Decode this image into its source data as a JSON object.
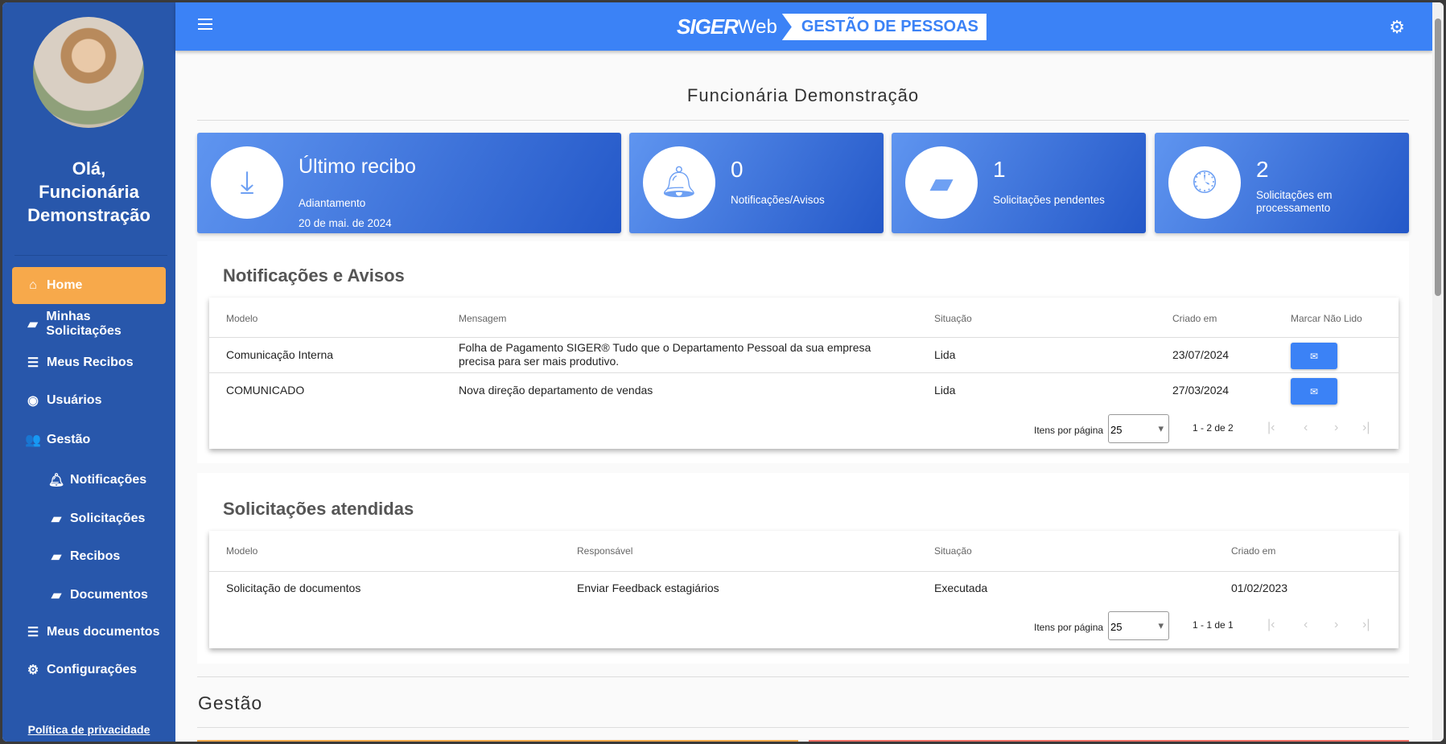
{
  "sidebar": {
    "greeting": "Olá,",
    "name_line1": "Funcionária",
    "name_line2": "Demonstração",
    "items": [
      {
        "label": "Home"
      },
      {
        "label": "Minhas Solicitações"
      },
      {
        "label": "Meus Recibos"
      },
      {
        "label": "Usuários"
      },
      {
        "label": "Gestão"
      },
      {
        "label": "Notificações"
      },
      {
        "label": "Solicitações"
      },
      {
        "label": "Recibos"
      },
      {
        "label": "Documentos"
      },
      {
        "label": "Meus documentos"
      },
      {
        "label": "Configurações"
      }
    ],
    "privacy": "Política de privacidade"
  },
  "header": {
    "logo_siger": "SIGER",
    "logo_web": "Web",
    "logo_product": "GESTÃO DE PESSOAS"
  },
  "page_title": "Funcionária Demonstração",
  "cards": {
    "receipt": {
      "title": "Último recibo",
      "type": "Adiantamento",
      "date": "20 de mai. de 2024"
    },
    "notifications": {
      "count": "0",
      "label": "Notificações/Avisos"
    },
    "pending": {
      "count": "1",
      "label": "Solicitações pendentes"
    },
    "processing": {
      "count": "2",
      "label": "Solicitações em processamento"
    }
  },
  "notifications": {
    "title": "Notificações e Avisos",
    "headers": [
      "Modelo",
      "Mensagem",
      "Situação",
      "Criado em",
      "Marcar Não Lido"
    ],
    "rows": [
      {
        "modelo": "Comunicação Interna",
        "mensagem": "Folha de Pagamento SIGER® Tudo que o Departamento Pessoal da sua empresa precisa para ser mais produtivo.",
        "situacao": "Lida",
        "criado": "23/07/2024"
      },
      {
        "modelo": "COMUNICADO",
        "mensagem": "Nova direção departamento de vendas",
        "situacao": "Lida",
        "criado": "27/03/2024"
      }
    ],
    "items_per_page_label": "Itens por página",
    "items_per_page": "25",
    "range": "1 - 2 de 2"
  },
  "requests": {
    "title": "Solicitações atendidas",
    "headers": [
      "Modelo",
      "Responsável",
      "Situação",
      "Criado em"
    ],
    "rows": [
      {
        "modelo": "Solicitação de documentos",
        "responsavel": "Enviar Feedback estagiários",
        "situacao": "Executada",
        "criado": "01/02/2023"
      }
    ],
    "items_per_page_label": "Itens por página",
    "items_per_page": "25",
    "range": "1 - 1 de 1"
  },
  "management": {
    "title": "Gestão"
  },
  "colors": {
    "sidebar": "#2857ab",
    "header": "#3b82f6",
    "active": "#f7a94b"
  }
}
